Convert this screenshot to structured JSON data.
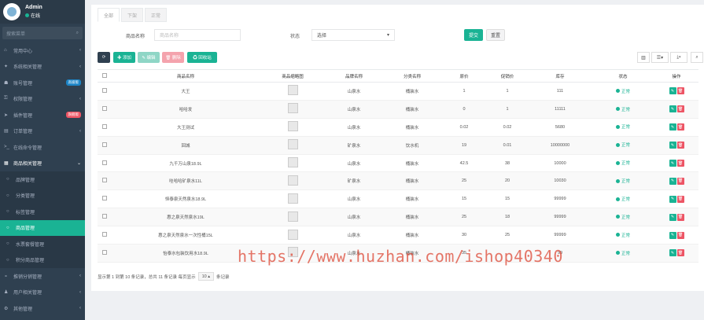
{
  "profile": {
    "name": "Admin",
    "status": "在线"
  },
  "sidebar": {
    "search_placeholder": "搜索菜单",
    "items": [
      {
        "icon": "home-icon",
        "glyph": "⌂",
        "label": "常用中心",
        "arrow": "‹",
        "badge": ""
      },
      {
        "icon": "puzzle-icon",
        "glyph": "✦",
        "label": "系统相关管理",
        "arrow": "‹",
        "badge": ""
      },
      {
        "icon": "users-icon",
        "glyph": "☗",
        "label": "账号管理",
        "arrow": "",
        "badge": "高级版",
        "badge_color": "#1c84c6"
      },
      {
        "icon": "lock-icon",
        "glyph": "⚿",
        "label": "权限管理",
        "arrow": "‹",
        "badge": ""
      },
      {
        "icon": "plane-icon",
        "glyph": "➤",
        "label": "插件管理",
        "arrow": "",
        "badge": "旗舰版",
        "badge_color": "#ed5565"
      },
      {
        "icon": "list-icon",
        "glyph": "▤",
        "label": "订单管理",
        "arrow": "‹",
        "badge": ""
      },
      {
        "icon": "terminal-icon",
        "glyph": ">_",
        "label": "在线命令管理",
        "arrow": "",
        "badge": ""
      },
      {
        "icon": "goods-icon",
        "glyph": "▦",
        "label": "商品相关管理",
        "arrow": "⌄",
        "badge": "",
        "open": true
      },
      {
        "icon": "circle-icon",
        "glyph": "○",
        "label": "品牌管理",
        "arrow": "",
        "badge": "",
        "sub": true
      },
      {
        "icon": "circle-icon",
        "glyph": "○",
        "label": "分类管理",
        "arrow": "",
        "badge": "",
        "sub": true
      },
      {
        "icon": "circle-icon",
        "glyph": "○",
        "label": "标签管理",
        "arrow": "",
        "badge": "",
        "sub": true
      },
      {
        "icon": "circle-icon",
        "glyph": "○",
        "label": "商品管理",
        "arrow": "",
        "badge": "",
        "sub": true,
        "active": true
      },
      {
        "icon": "circle-icon",
        "glyph": "○",
        "label": "水票套餐管理",
        "arrow": "",
        "badge": "",
        "sub": true
      },
      {
        "icon": "circle-icon",
        "glyph": "○",
        "label": "积分商品管理",
        "arrow": "",
        "badge": "",
        "sub": true
      },
      {
        "icon": "share-icon",
        "glyph": "⚬",
        "label": "推销分销管理",
        "arrow": "‹",
        "badge": ""
      },
      {
        "icon": "user-icon",
        "glyph": "♟",
        "label": "用户相关管理",
        "arrow": "‹",
        "badge": ""
      },
      {
        "icon": "cog-icon",
        "glyph": "⚙",
        "label": "其他管理",
        "arrow": "‹",
        "badge": ""
      }
    ]
  },
  "tabs": [
    "全部",
    "下架",
    "正常"
  ],
  "filters": {
    "name_label": "商品名称",
    "name_placeholder": "商品名称",
    "status_label": "状态",
    "status_value": "选择",
    "submit": "提交",
    "reset": "重置"
  },
  "toolbar": {
    "refresh": "⟳",
    "add": "✚ 添加",
    "edit": "✎ 编辑",
    "delete": "🗑 删除",
    "recycle": "♻ 回收站"
  },
  "table": {
    "headers": [
      "商品名称",
      "商品缩略图",
      "品牌名称",
      "分类名称",
      "原价",
      "促销价",
      "库存",
      "状态",
      "操作"
    ],
    "rows": [
      {
        "name": "大王",
        "brand": "山泉水",
        "category": "桶装水",
        "price": "1",
        "promo": "1",
        "stock": "111",
        "status": "正常"
      },
      {
        "name": "哈哈发",
        "brand": "山泉水",
        "category": "桶装水",
        "price": "0",
        "promo": "1",
        "stock": "11111",
        "status": "正常"
      },
      {
        "name": "大王测试",
        "brand": "山泉水",
        "category": "桶装水",
        "price": "0.02",
        "promo": "0.02",
        "stock": "5680",
        "status": "正常"
      },
      {
        "name": "回城",
        "brand": "矿泉水",
        "category": "饮水机",
        "price": "19",
        "promo": "0.01",
        "stock": "10000000",
        "status": "正常"
      },
      {
        "name": "九千万山泉18.9L",
        "brand": "山泉水",
        "category": "桶装水",
        "price": "42.5",
        "promo": "38",
        "stock": "10000",
        "status": "正常"
      },
      {
        "name": "哇哈哈矿泉水11L",
        "brand": "矿泉水",
        "category": "桶装水",
        "price": "25",
        "promo": "20",
        "stock": "10030",
        "status": "正常"
      },
      {
        "name": "恒泰泉天然泉水18.9L",
        "brand": "山泉水",
        "category": "桶装水",
        "price": "15",
        "promo": "15",
        "stock": "99999",
        "status": "正常"
      },
      {
        "name": "惠之泉天然泉水19L",
        "brand": "山泉水",
        "category": "桶装水",
        "price": "25",
        "promo": "18",
        "stock": "99999",
        "status": "正常"
      },
      {
        "name": "惠之泉天然泉水一次性桶15L",
        "brand": "山泉水",
        "category": "桶装水",
        "price": "30",
        "promo": "25",
        "stock": "99999",
        "status": "正常"
      },
      {
        "name": "怡泰水包装饮用水18.9L",
        "brand": "山泉水",
        "category": "桶装水",
        "price": "35",
        "promo": "",
        "stock": "99",
        "status": "正常"
      }
    ]
  },
  "pager": {
    "summary": "显示第 1 到第 10 条记录，总共 11 条记录 每页显示",
    "page_size": "10",
    "suffix": "条记录"
  },
  "watermark": "https://www.huzhan.com/ishop40340"
}
